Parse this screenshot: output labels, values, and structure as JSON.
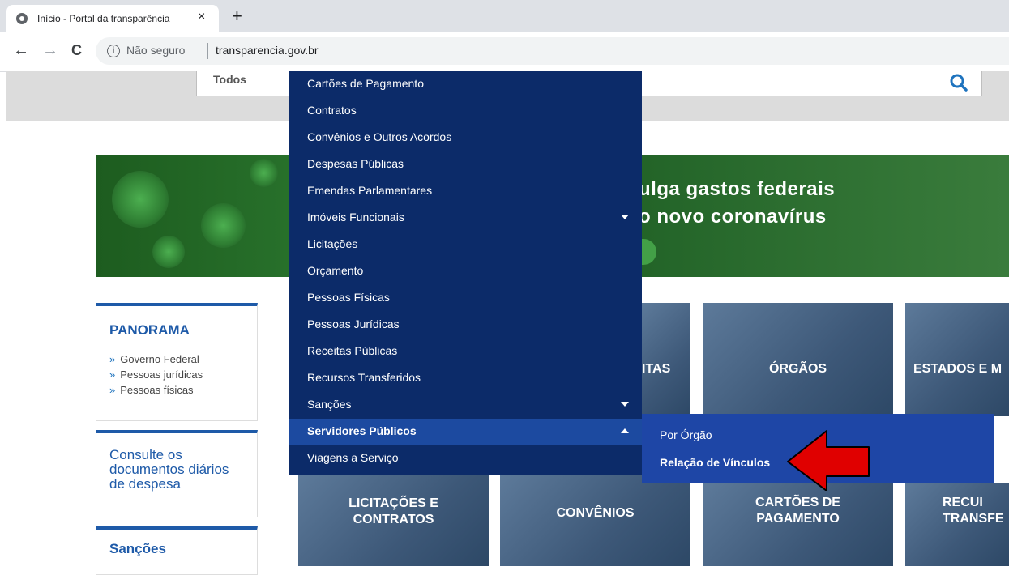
{
  "browser": {
    "tab_title": "Início - Portal da transparência",
    "tab_close": "×",
    "new_tab": "+",
    "back": "←",
    "forward": "→",
    "reload": "C",
    "info": "i",
    "security_text": "Não seguro",
    "url": "transparencia.gov.br"
  },
  "search": {
    "filter_label": "Todos",
    "icon": "search-icon"
  },
  "banner": {
    "line1": "ulga gastos federais",
    "line2": "o novo coronavírus"
  },
  "sidebar": {
    "panorama_title": "PANORAMA",
    "panorama_links": [
      "Governo Federal",
      "Pessoas jurídicas",
      "Pessoas físicas"
    ],
    "bullet": "»",
    "consulte": "Consulte os documentos diários de despesa",
    "sancoes": "Sanções"
  },
  "cards": {
    "receitas_partial": "ITAS",
    "orgaos": "ÓRGÃOS",
    "estados_partial": "ESTADOS E M",
    "licitacoes_line1": "LICITAÇÕES E",
    "licitacoes_line2": "CONTRATOS",
    "convenios": "CONVÊNIOS",
    "cartoes_line1": "CARTÕES DE",
    "cartoes_line2": "PAGAMENTO",
    "recursos_line1": "RECUI",
    "recursos_line2": "TRANSFE"
  },
  "menu": {
    "items": [
      {
        "label": "Cartões de Pagamento",
        "caret": ""
      },
      {
        "label": "Contratos",
        "caret": ""
      },
      {
        "label": "Convênios e Outros Acordos",
        "caret": ""
      },
      {
        "label": "Despesas Públicas",
        "caret": ""
      },
      {
        "label": "Emendas Parlamentares",
        "caret": ""
      },
      {
        "label": "Imóveis Funcionais",
        "caret": "down"
      },
      {
        "label": "Licitações",
        "caret": ""
      },
      {
        "label": "Orçamento",
        "caret": ""
      },
      {
        "label": "Pessoas Físicas",
        "caret": ""
      },
      {
        "label": "Pessoas Jurídicas",
        "caret": ""
      },
      {
        "label": "Receitas Públicas",
        "caret": ""
      },
      {
        "label": "Recursos Transferidos",
        "caret": ""
      },
      {
        "label": "Sanções",
        "caret": "down"
      },
      {
        "label": "Servidores Públicos",
        "caret": "up",
        "active": true
      },
      {
        "label": "Viagens a Serviço",
        "caret": ""
      }
    ]
  },
  "submenu": {
    "items": [
      "Por Órgão",
      "Relação de Vínculos"
    ]
  },
  "colors": {
    "menu_bg": "#0c2b69",
    "menu_active": "#1c4aa0",
    "submenu_bg": "#1e46a6",
    "arrow": "#e00000"
  }
}
